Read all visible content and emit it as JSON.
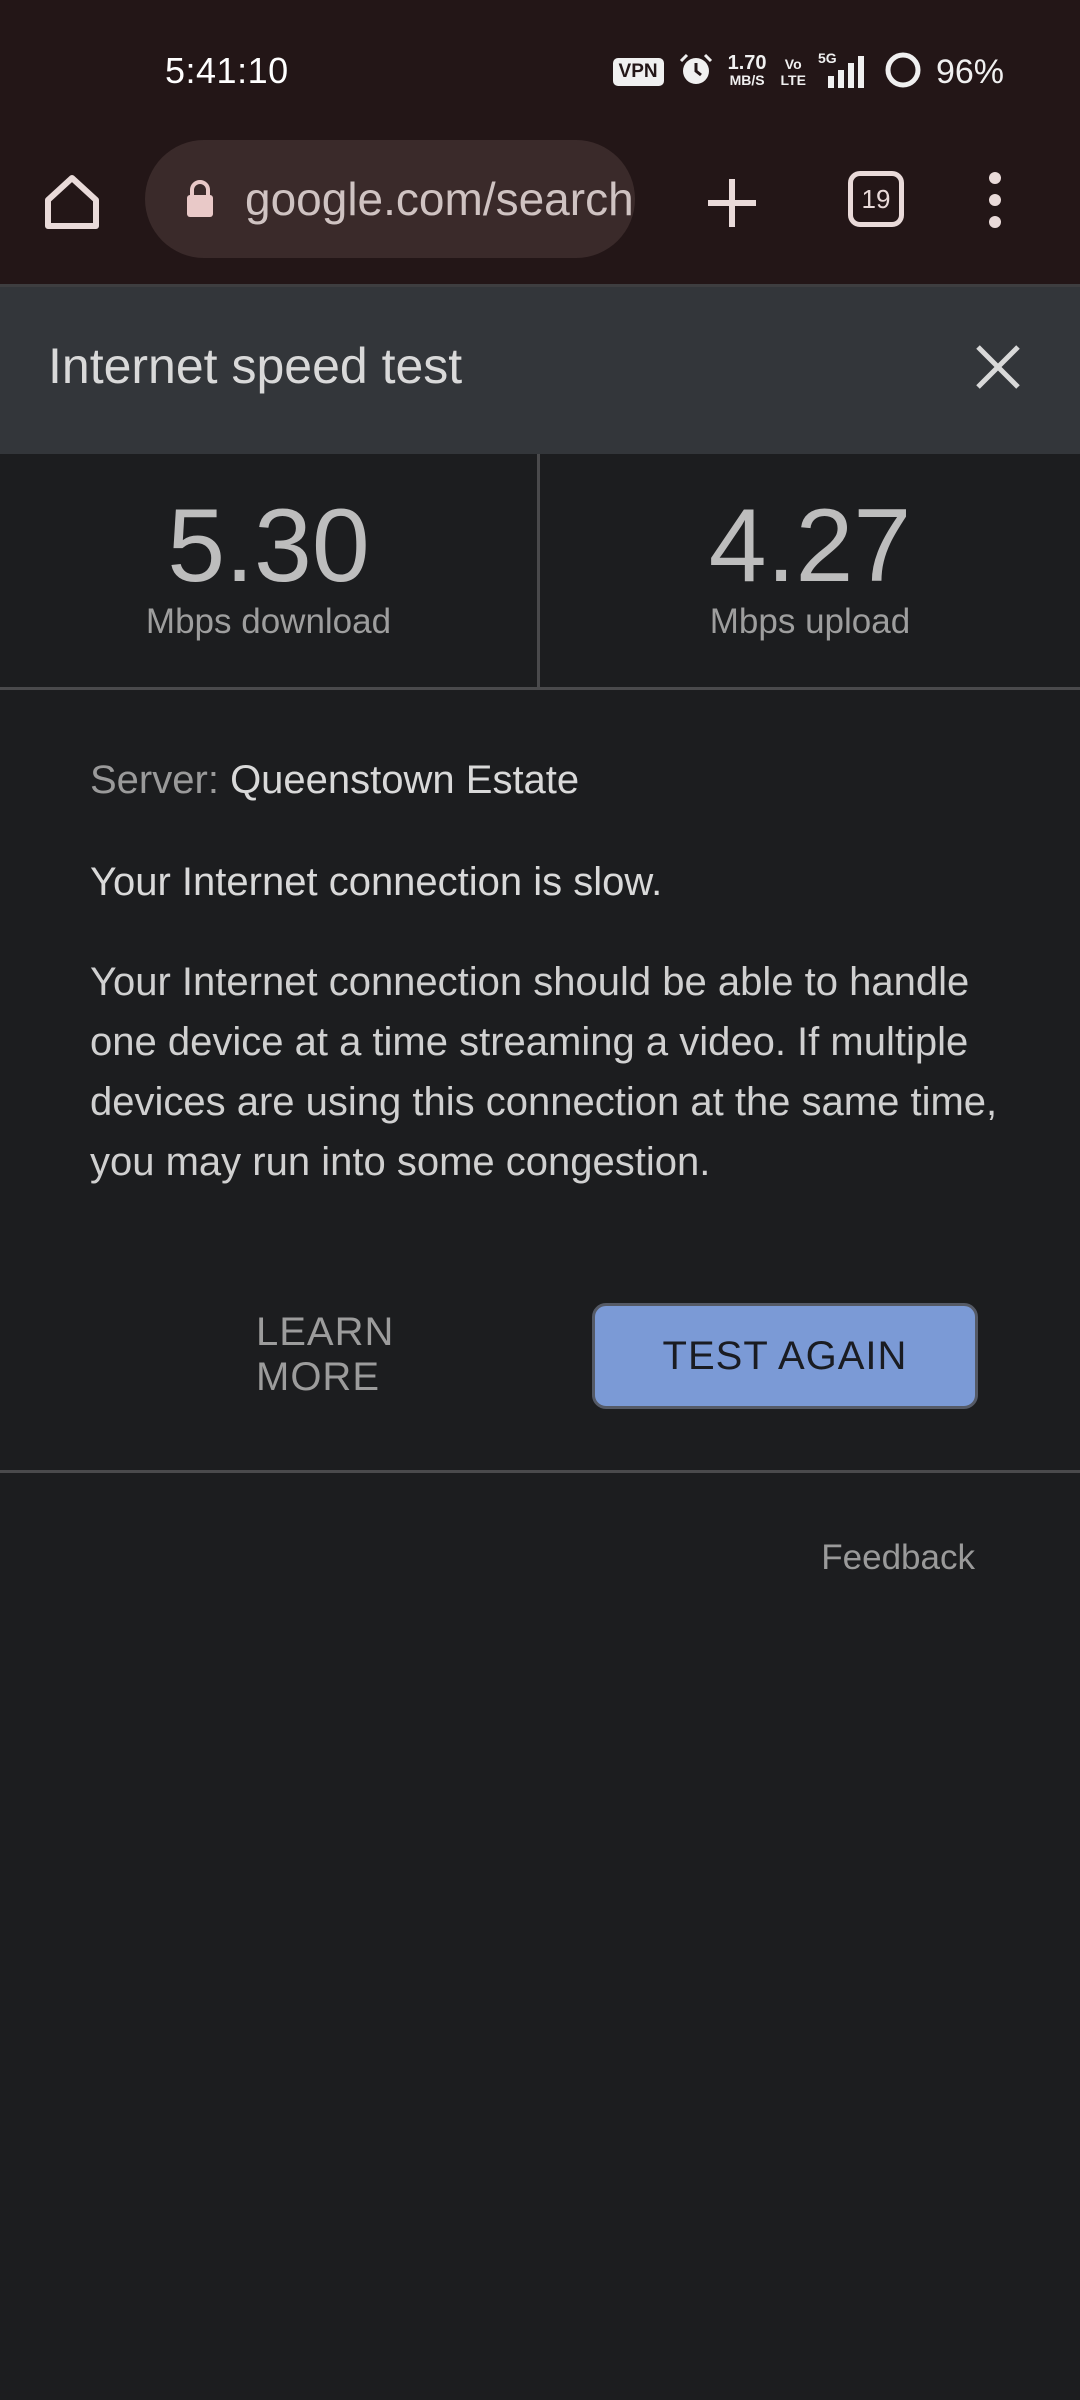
{
  "status_bar": {
    "time": "5:41:10",
    "vpn_label": "VPN",
    "net_speed_value": "1.70",
    "net_speed_unit": "MB/S",
    "volte_top": "Vo",
    "volte_bottom": "LTE",
    "network_type": "5G",
    "battery_percent": "96%",
    "icons": [
      "alarm-icon",
      "signal-icon",
      "battery-icon"
    ]
  },
  "browser": {
    "url": "google.com/search",
    "tab_count": "19",
    "icons": [
      "home-icon",
      "lock-icon",
      "plus-icon",
      "tabs-icon",
      "more-vert-icon"
    ]
  },
  "speed_test": {
    "title": "Internet speed test",
    "download_value": "5.30",
    "download_unit": "Mbps download",
    "upload_value": "4.27",
    "upload_unit": "Mbps upload",
    "server_label": "Server:",
    "server_name": "Queenstown Estate",
    "verdict": "Your Internet connection is slow.",
    "description": "Your Internet connection should be able to handle one device at a time streaming a video. If multiple devices are using this connection at the same time, you may run into some congestion.",
    "learn_more_label": "LEARN MORE",
    "test_again_label": "TEST AGAIN",
    "feedback_label": "Feedback"
  },
  "colors": {
    "status_bg": "#231617",
    "page_bg": "#1c1d1f",
    "header_bg": "#33363a",
    "button_bg": "#7b9ad6"
  }
}
